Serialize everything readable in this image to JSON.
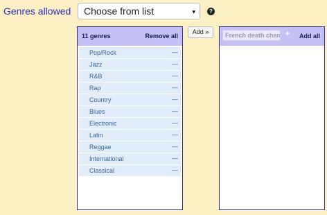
{
  "genres": {
    "label": "Genres allowed",
    "select_value": "Choose from list",
    "chevron": "▾",
    "help_symbol": "?"
  },
  "selected_panel": {
    "count": "11 genres",
    "remove_all_label": "Remove all",
    "items": [
      {
        "label": "Pop/Rock",
        "remove": "—"
      },
      {
        "label": "Jazz",
        "remove": "—"
      },
      {
        "label": "R&B",
        "remove": "—"
      },
      {
        "label": "Rap",
        "remove": "—"
      },
      {
        "label": "Country",
        "remove": "—"
      },
      {
        "label": "Blues",
        "remove": "—"
      },
      {
        "label": "Electronic",
        "remove": "—"
      },
      {
        "label": "Latin",
        "remove": "—"
      },
      {
        "label": "Reggae",
        "remove": "—"
      },
      {
        "label": "International",
        "remove": "—"
      },
      {
        "label": "Classical",
        "remove": "—"
      }
    ]
  },
  "add_button_label": "Add »",
  "available_panel": {
    "search_placeholder": "French death chant",
    "plus_symbol": "+",
    "add_all_label": "Add all"
  },
  "colors": {
    "page_bg": "#fdf0c4",
    "label": "#2a2ab8",
    "panel_header": "#c5c1f5",
    "list_item": "#e2edfb",
    "list_text": "#38659a"
  }
}
